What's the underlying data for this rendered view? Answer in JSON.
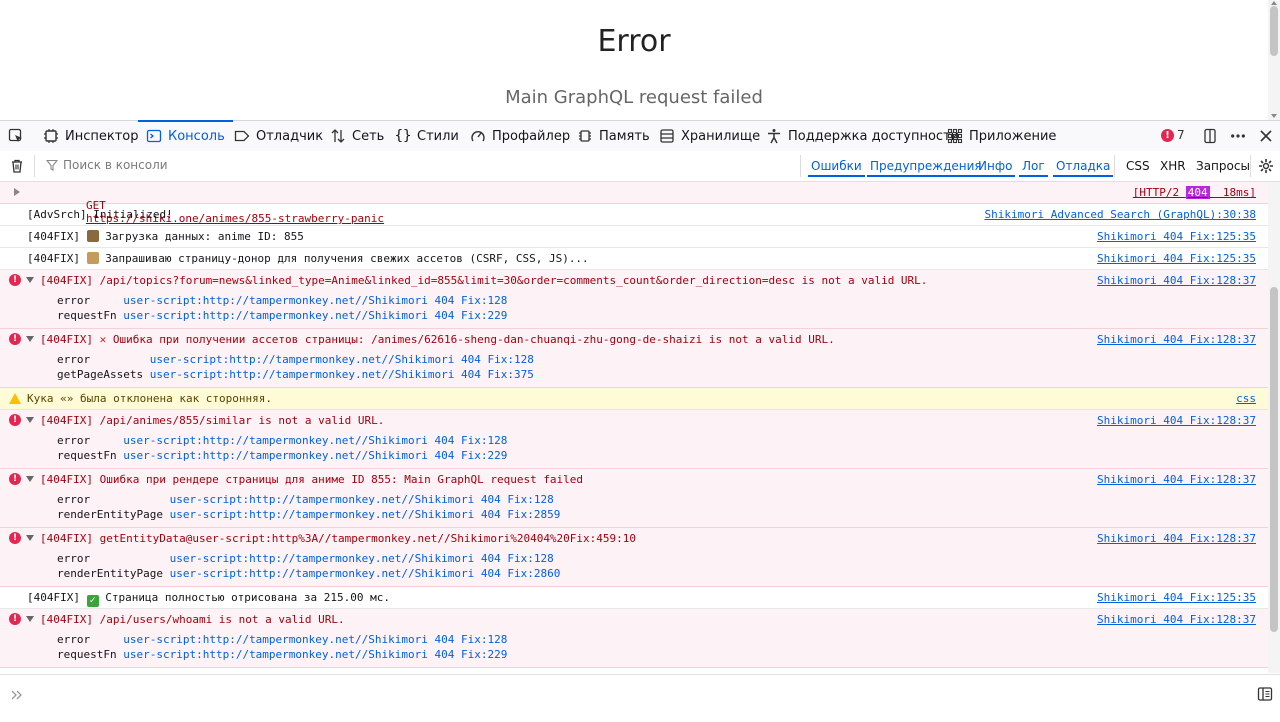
{
  "page": {
    "title": "Error",
    "subtitle": "Main GraphQL request failed"
  },
  "devtools": {
    "tabs": {
      "inspector": "Инспектор",
      "console": "Консоль",
      "debugger": "Отладчик",
      "network": "Сеть",
      "styles": "Стили",
      "profiler": "Профайлер",
      "memory": "Память",
      "storage": "Хранилище",
      "accessibility": "Поддержка доступности",
      "application": "Приложение"
    },
    "error_count": "7"
  },
  "filterbar": {
    "placeholder": "Поиск в консоли",
    "errors": "Ошибки",
    "warnings": "Предупреждения",
    "info": "Инфо",
    "log": "Лог",
    "debug": "Отладка",
    "css": "CSS",
    "xhr": "XHR",
    "requests": "Запросы"
  },
  "log": {
    "r1": {
      "method": "GET",
      "url": "https://shiki.one/animes/855-strawberry-panic",
      "status_pre": "[HTTP/2 ",
      "status": "404",
      "status_post": "  18ms]"
    },
    "r2": {
      "msg": "[AdvSrch] Initialized!",
      "src": "Shikimori Advanced Search (GraphQL):30:38"
    },
    "r3": {
      "prefix": "[404FIX]",
      "msg": "Загрузка данных: anime ID: 855",
      "src": "Shikimori 404 Fix:125:35"
    },
    "r4": {
      "prefix": "[404FIX]",
      "msg": "Запрашиваю страницу-донор для получения свежих ассетов (CSRF, CSS, JS)...",
      "src": "Shikimori 404 Fix:125:35"
    },
    "r5": {
      "msg": "[404FIX] /api/topics?forum=news&linked_type=Anime&linked_id=855&limit=30&order=comments_count&order_direction=desc is not a valid URL.",
      "src": "Shikimori 404 Fix:128:37",
      "t1f": "error    ",
      "t1l": "user-script:http://tampermonkey.net//Shikimori 404 Fix:128",
      "t2f": "requestFn",
      "t2l": "user-script:http://tampermonkey.net//Shikimori 404 Fix:229"
    },
    "r6": {
      "pre": "[404FIX]",
      "msg": "Ошибка при получении ассетов страницы: /animes/62616-sheng-dan-chuanqi-zhu-gong-de-shaizi is not a valid URL.",
      "src": "Shikimori 404 Fix:128:37",
      "t1f": "error        ",
      "t1l": "user-script:http://tampermonkey.net//Shikimori 404 Fix:128",
      "t2f": "getPageAssets",
      "t2l": "user-script:http://tampermonkey.net//Shikimori 404 Fix:375"
    },
    "r7": {
      "msg": "Кука «» была отклонена как сторонняя.",
      "src": "css"
    },
    "r8": {
      "msg": "[404FIX] /api/animes/855/similar is not a valid URL.",
      "src": "Shikimori 404 Fix:128:37",
      "t1f": "error    ",
      "t1l": "user-script:http://tampermonkey.net//Shikimori 404 Fix:128",
      "t2f": "requestFn",
      "t2l": "user-script:http://tampermonkey.net//Shikimori 404 Fix:229"
    },
    "r9": {
      "msg": "[404FIX] Ошибка при рендере страницы для аниме ID 855: Main GraphQL request failed",
      "src": "Shikimori 404 Fix:128:37",
      "t1f": "error           ",
      "t1l": "user-script:http://tampermonkey.net//Shikimori 404 Fix:128",
      "t2f": "renderEntityPage",
      "t2l": "user-script:http://tampermonkey.net//Shikimori 404 Fix:2859"
    },
    "r10": {
      "msg": "[404FIX] getEntityData@user-script:http%3A//tampermonkey.net//Shikimori%20404%20Fix:459:10",
      "src": "Shikimori 404 Fix:128:37",
      "t1f": "error           ",
      "t1l": "user-script:http://tampermonkey.net//Shikimori 404 Fix:128",
      "t2f": "renderEntityPage",
      "t2l": "user-script:http://tampermonkey.net//Shikimori 404 Fix:2860"
    },
    "r11": {
      "prefix": "[404FIX]",
      "msg": "Страница полностью отрисована за 215.00 мс.",
      "src": "Shikimori 404 Fix:125:35"
    },
    "r12": {
      "msg": "[404FIX] /api/users/whoami is not a valid URL.",
      "src": "Shikimori 404 Fix:128:37",
      "t1f": "error    ",
      "t1l": "user-script:http://tampermonkey.net//Shikimori 404 Fix:128",
      "t2f": "requestFn",
      "t2l": "user-script:http://tampermonkey.net//Shikimori 404 Fix:229"
    }
  }
}
